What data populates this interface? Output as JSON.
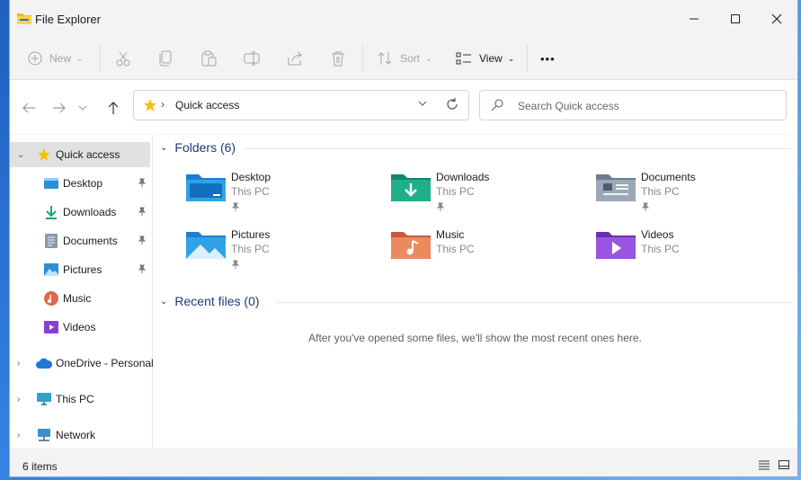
{
  "window": {
    "title": "File Explorer"
  },
  "toolbar": {
    "new_label": "New",
    "sort_label": "Sort",
    "view_label": "View",
    "more_label": "•••"
  },
  "address": {
    "path": "Quick access"
  },
  "search": {
    "placeholder": "Search Quick access"
  },
  "sidebar": {
    "items": [
      {
        "label": "Quick access"
      },
      {
        "label": "Desktop"
      },
      {
        "label": "Downloads"
      },
      {
        "label": "Documents"
      },
      {
        "label": "Pictures"
      },
      {
        "label": "Music"
      },
      {
        "label": "Videos"
      },
      {
        "label": "OneDrive - Personal"
      },
      {
        "label": "This PC"
      },
      {
        "label": "Network"
      }
    ]
  },
  "folders_group": {
    "title": "Folders (6)"
  },
  "folders": [
    {
      "name": "Desktop",
      "location": "This PC",
      "icon": "desktop-folder-icon",
      "pinned": true
    },
    {
      "name": "Downloads",
      "location": "This PC",
      "icon": "downloads-folder-icon",
      "pinned": true
    },
    {
      "name": "Documents",
      "location": "This PC",
      "icon": "documents-folder-icon",
      "pinned": true
    },
    {
      "name": "Pictures",
      "location": "This PC",
      "icon": "pictures-folder-icon",
      "pinned": true
    },
    {
      "name": "Music",
      "location": "This PC",
      "icon": "music-folder-icon",
      "pinned": false
    },
    {
      "name": "Videos",
      "location": "This PC",
      "icon": "videos-folder-icon",
      "pinned": false
    }
  ],
  "recent_group": {
    "title": "Recent files (0)",
    "empty_message": "After you've opened some files, we'll show the most recent ones here."
  },
  "status": {
    "item_count": "6 items"
  },
  "colors": {
    "accent": "#1f3a73",
    "selection": "#e1e1e1",
    "star": "#f7c200"
  }
}
